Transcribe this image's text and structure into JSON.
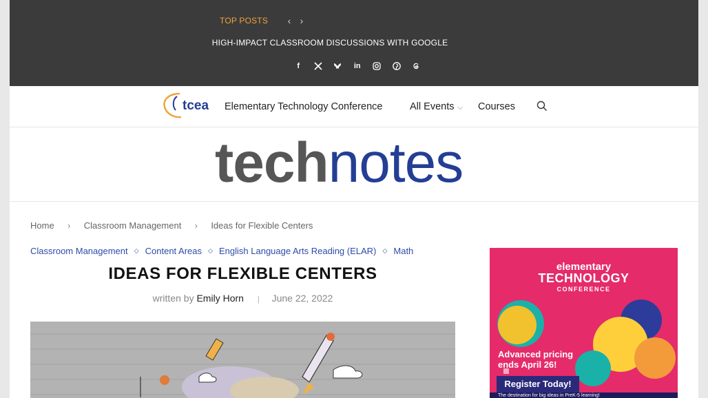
{
  "topbar": {
    "label": "TOP POSTS",
    "prev_icon": "‹",
    "next_icon": "›",
    "headline": "HIGH-IMPACT CLASSROOM DISCUSSIONS WITH GOOGLE",
    "socials": [
      {
        "icon": "facebook-icon",
        "glyph": "f"
      },
      {
        "icon": "x-icon",
        "glyph": "𝕏"
      },
      {
        "icon": "bluesky-icon",
        "glyph": ""
      },
      {
        "icon": "linkedin-icon",
        "glyph": "in"
      },
      {
        "icon": "instagram-icon",
        "glyph": ""
      },
      {
        "icon": "pinterest-icon",
        "glyph": ""
      },
      {
        "icon": "threads-icon",
        "glyph": ""
      }
    ]
  },
  "nav": {
    "logo_text": "tcea",
    "items": [
      {
        "label": "Elementary Technology Conference"
      },
      {
        "label": "All Events",
        "dropdown": true
      },
      {
        "label": "Courses"
      }
    ]
  },
  "brand": {
    "part1": "tech",
    "part2": "notes"
  },
  "breadcrumb": [
    "Home",
    "Classroom Management",
    "Ideas for Flexible Centers"
  ],
  "categories": [
    "Classroom Management",
    "Content Areas",
    "English Language Arts Reading (ELAR)",
    "Math"
  ],
  "article": {
    "title": "IDEAS FOR FLEXIBLE CENTERS",
    "written_by": "written by",
    "author": "Emily Horn",
    "date": "June 22, 2022"
  },
  "ad": {
    "line1": "elementary",
    "line2": "TECHNOLOGY",
    "line3": "CONFERENCE",
    "pricing": "Advanced pricing ends April 26!",
    "button": "Register Today!",
    "footer": "The destination for big ideas in PreK-5 learning!"
  },
  "colors": {
    "topbar": "#3b3b3b",
    "accent": "#f2a33a",
    "link": "#2d4ba8",
    "brand_blue": "#243e94",
    "ad_pink": "#e52b6a"
  }
}
